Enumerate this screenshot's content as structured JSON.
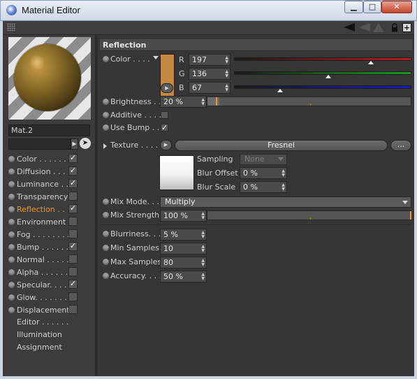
{
  "window": {
    "title": "Material Editor",
    "min_glyph": "▁",
    "max_glyph": "□",
    "close_glyph": "✕"
  },
  "toolbar": {
    "icons": [
      "grip-icon",
      "arrow-left-icon",
      "arrow-right-icon",
      "arrow-up-icon",
      "lock-icon",
      "new-panel-icon"
    ],
    "new_panel_glyph": "+"
  },
  "material": {
    "name": "Mat.2",
    "preview_color": "#c58843"
  },
  "channels": [
    {
      "label": "Color . . . . . .",
      "checked": true,
      "check": "✓"
    },
    {
      "label": "Diffusion . . .",
      "checked": true,
      "check": "✓"
    },
    {
      "label": "Luminance . .",
      "checked": true,
      "check": "✓"
    },
    {
      "label": "Transparency",
      "checked": false,
      "check": ""
    },
    {
      "label": "Reflection . .",
      "checked": true,
      "check": "✓",
      "active": true
    },
    {
      "label": "Environment",
      "checked": false,
      "check": ""
    },
    {
      "label": "Fog . . . . . . . .",
      "checked": false,
      "check": ""
    },
    {
      "label": "Bump . . . . . .",
      "checked": true,
      "check": "✓"
    },
    {
      "label": "Normal . . . . .",
      "checked": false,
      "check": ""
    },
    {
      "label": "Alpha . . . . . .",
      "checked": false,
      "check": ""
    },
    {
      "label": "Specular. . . .",
      "checked": true,
      "check": "✓"
    },
    {
      "label": "Glow. . . . . . .",
      "checked": false,
      "check": ""
    },
    {
      "label": "Displacement",
      "checked": false,
      "check": ""
    }
  ],
  "extras": [
    "Editor . . . . . .",
    "Illumination",
    "Assignment"
  ],
  "reflection": {
    "header": "Reflection",
    "color": {
      "label": "Color . . . .",
      "hex": "#c58843",
      "r_label": "R",
      "r": "197",
      "r_frac": 0.77,
      "g_label": "G",
      "g": "136",
      "g_frac": 0.53,
      "b_label": "B",
      "b": "67",
      "b_frac": 0.26,
      "r_color": "#b81c1c",
      "g_color": "#1c9a1c",
      "b_color": "#1a1ab8"
    },
    "brightness": {
      "label": "Brightness . .",
      "value": "20 %",
      "fraction": 0.2
    },
    "additive": {
      "label": "Additive . . . .",
      "checked": false,
      "check": ""
    },
    "use_bump": {
      "label": "Use Bump . .",
      "checked": true,
      "check": "✓"
    },
    "texture": {
      "label": "Texture . . . . .",
      "shader": "Fresnel",
      "more": "...",
      "sampling_label": "Sampling",
      "sampling_value": "None",
      "blur_offset_label": "Blur Offset",
      "blur_offset_value": "0 %",
      "blur_scale_label": "Blur Scale",
      "blur_scale_value": "0 %"
    },
    "mix_mode": {
      "label": "Mix Mode. . .",
      "value": "Multiply"
    },
    "mix_strength": {
      "label": "Mix Strength",
      "value": "100 %",
      "fraction": 1.0
    },
    "blurriness": {
      "label": "Blurriness. . .",
      "value": "5 %"
    },
    "min_samples": {
      "label": "Min Samples",
      "value": "10"
    },
    "max_samples": {
      "label": "Max Samples",
      "value": "80"
    },
    "accuracy": {
      "label": "Accuracy. . . .",
      "value": "50 %"
    }
  }
}
